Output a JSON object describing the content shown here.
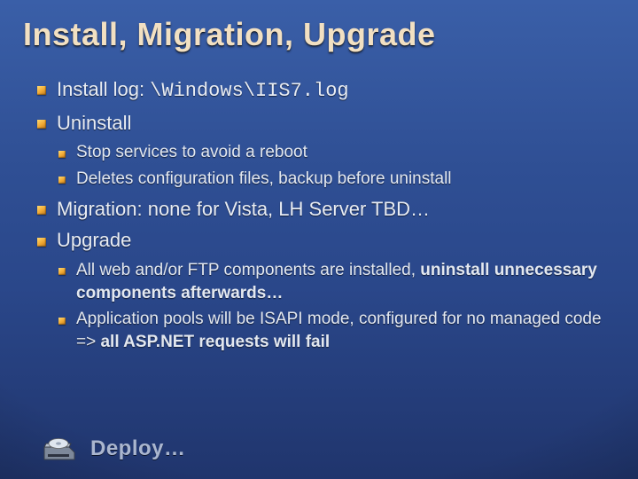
{
  "title": "Install, Migration, Upgrade",
  "bullets": {
    "b1_prefix": "Install log: ",
    "b1_path": "\\Windows\\IIS7.log",
    "b2": "Uninstall",
    "b2_1": "Stop services to avoid a reboot",
    "b2_2": "Deletes configuration files, backup before uninstall",
    "b3": "Migration: none for Vista, LH Server TBD…",
    "b4": "Upgrade",
    "b4_1a": "All web and/or FTP components are installed, ",
    "b4_1b": "uninstall unnecessary components afterwards…",
    "b4_2a": "Application pools will be ISAPI mode, configured for no managed code => ",
    "b4_2b": "all ASP.NET requests will fail"
  },
  "footer": {
    "label": "Deploy…"
  },
  "icons": {
    "bullet": "square-bullet-icon",
    "footer": "cd-drive-icon"
  }
}
